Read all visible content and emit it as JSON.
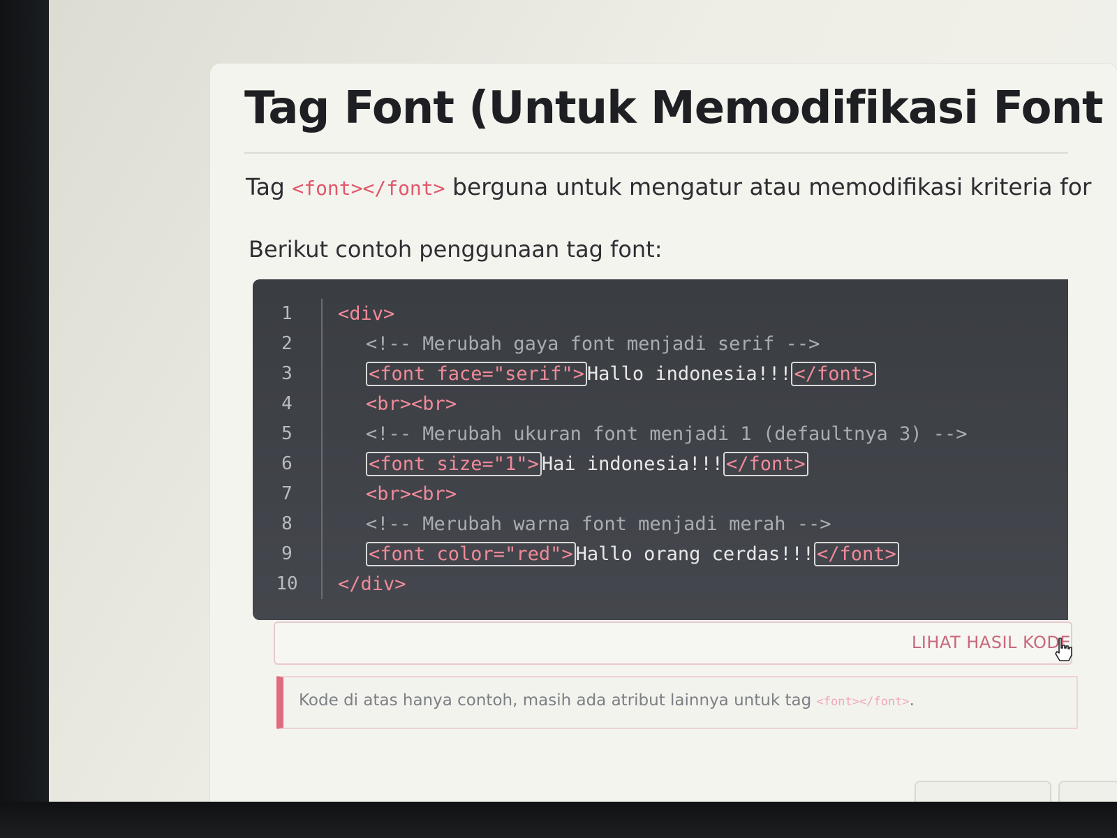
{
  "article": {
    "title": "Tag Font (Untuk Memodifikasi Font",
    "intro_prefix": "Tag ",
    "intro_code": "<font></font>",
    "intro_suffix": " berguna untuk mengatur atau memodifikasi kriteria for",
    "example_label": "Berikut contoh penggunaan tag font:"
  },
  "code": {
    "line_numbers": [
      "1",
      "2",
      "3",
      "4",
      "5",
      "6",
      "7",
      "8",
      "9",
      "10"
    ],
    "line1": "<div>",
    "line2": "<!-- Merubah gaya font menjadi serif -->",
    "line3_open": "<font face=\"serif\">",
    "line3_text": "Hallo indonesia!!!",
    "line3_close": "</font>",
    "line4": "<br><br>",
    "line5": "<!-- Merubah ukuran font menjadi 1 (defaultnya 3) -->",
    "line6_open": "<font size=\"1\">",
    "line6_text": "Hai indonesia!!!",
    "line6_close": "</font>",
    "line7": "<br><br>",
    "line8": "<!-- Merubah warna font menjadi merah -->",
    "line9_open": "<font color=\"red\">",
    "line9_text": "Hallo orang cerdas!!!",
    "line9_close": "</font>",
    "line10": "</div>"
  },
  "result_button": {
    "label": "LIHAT HASIL KODE"
  },
  "note": {
    "text": "Kode di atas hanya contoh, masih ada atribut lainnya untuk tag ",
    "code": "<font></font>",
    "end": "."
  },
  "colors": {
    "accent": "#e0586a",
    "code_bg": "#3a3d42",
    "page_bg": "#f4f4ef"
  },
  "icons": {
    "cursor": "hand-pointer-icon"
  }
}
